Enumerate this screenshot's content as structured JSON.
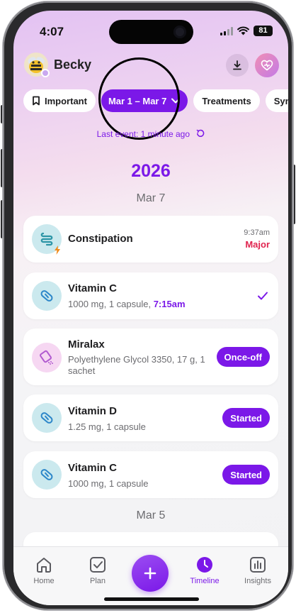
{
  "status": {
    "time": "4:07",
    "battery": "81"
  },
  "user": {
    "name": "Becky"
  },
  "chips": [
    {
      "label": "Important",
      "icon": "bookmark-icon"
    },
    {
      "label": "Mar 1 – Mar 7",
      "icon": "chevron-down-icon"
    },
    {
      "label": "Treatments"
    },
    {
      "label": "Symp"
    }
  ],
  "last_event": "Last event: 1 minute ago",
  "year": "2026",
  "sections": [
    {
      "date": "Mar 7"
    },
    {
      "date": "Mar 5"
    }
  ],
  "events": [
    {
      "title": "Constipation",
      "time": "9:37am",
      "severity": "Major",
      "icon": "intestine-icon"
    },
    {
      "title": "Vitamin C",
      "detail": "1000 mg, 1 capsule, ",
      "taken_time": "7:15am",
      "icon": "pill-icon",
      "status_icon": "check-icon"
    },
    {
      "title": "Miralax",
      "detail": "Polyethylene Glycol 3350, 17 g, 1 sachet",
      "action": "Once-off",
      "icon": "sachet-icon"
    },
    {
      "title": "Vitamin D",
      "detail": "1.25 mg, 1 capsule",
      "action": "Started",
      "icon": "pill-icon"
    },
    {
      "title": "Vitamin C",
      "detail": "1000 mg, 1 capsule",
      "action": "Started",
      "icon": "pill-icon"
    }
  ],
  "tabs": [
    {
      "label": "Home",
      "icon": "home-icon"
    },
    {
      "label": "Plan",
      "icon": "checkbox-icon"
    },
    {
      "label": "Timeline",
      "icon": "clock-icon"
    },
    {
      "label": "Insights",
      "icon": "bar-chart-icon"
    }
  ],
  "colors": {
    "accent": "#7b18e8",
    "severity": "#e0244f"
  }
}
